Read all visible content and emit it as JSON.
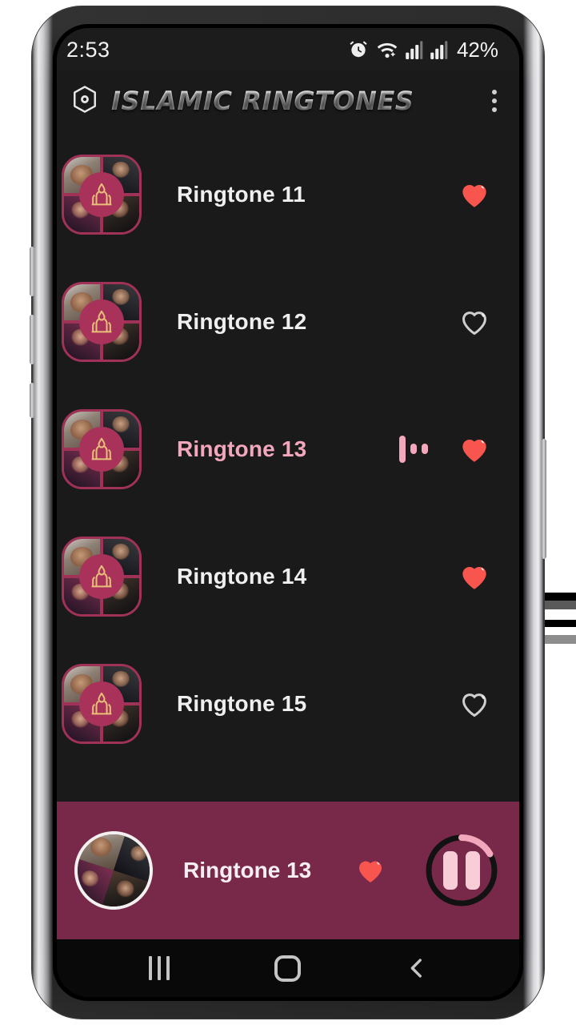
{
  "status_bar": {
    "time": "2:53",
    "battery": "42%",
    "icons": [
      "alarm-icon",
      "wifi-icon",
      "signal-icon-1",
      "signal-icon-2"
    ]
  },
  "app_bar": {
    "logo_icon": "hexagon-record-icon",
    "title": "ISLAMIC RINGTONES",
    "overflow_icon": "more-vertical-icon"
  },
  "list": {
    "items": [
      {
        "title": "Ringtone 11",
        "favorite": true,
        "playing": false
      },
      {
        "title": "Ringtone 12",
        "favorite": false,
        "playing": false
      },
      {
        "title": "Ringtone 13",
        "favorite": true,
        "playing": true
      },
      {
        "title": "Ringtone 14",
        "favorite": true,
        "playing": false
      },
      {
        "title": "Ringtone 15",
        "favorite": false,
        "playing": false
      }
    ]
  },
  "player": {
    "title": "Ringtone 13",
    "favorite": true,
    "state": "playing",
    "play_icon": "pause-icon",
    "progress_percent": 15,
    "art_icon": "mosque-icon"
  },
  "navigation": {
    "recents_label": "recents-icon",
    "home_label": "home-icon",
    "back_label": "back-icon"
  },
  "colors": {
    "accent": "#a83259",
    "player_bg": "#78294a",
    "favorite": "#f8554f",
    "active_text": "#f2a7bd",
    "screen_bg": "#1b1a1a"
  }
}
